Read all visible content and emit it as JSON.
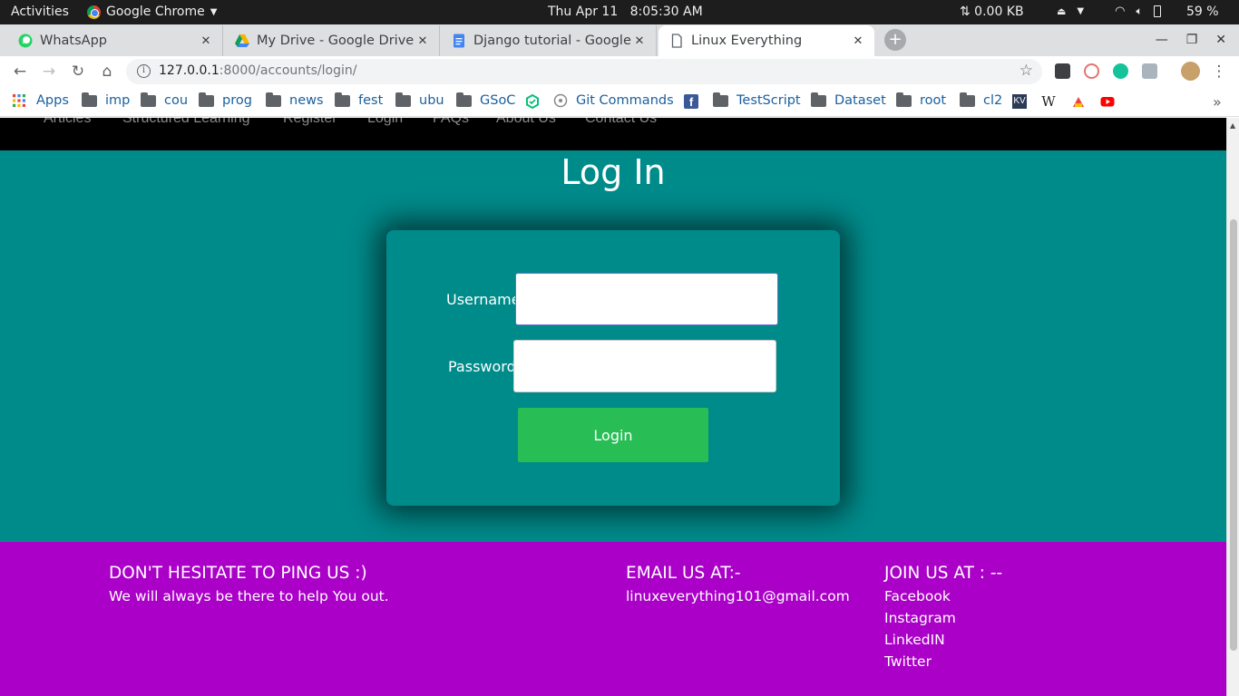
{
  "system_bar": {
    "activities": "Activities",
    "app_name": "Google Chrome",
    "clock": "Thu Apr 11   8:05:30 AM",
    "net_speed": "⇅ 0.00 KB",
    "battery": "59 %"
  },
  "tabs": [
    {
      "title": "WhatsApp",
      "icon": "whatsapp-icon",
      "active": false
    },
    {
      "title": "My Drive - Google Drive",
      "icon": "google-drive-icon",
      "active": false
    },
    {
      "title": "Django tutorial - Google D",
      "icon": "google-docs-icon",
      "active": false
    },
    {
      "title": "Linux Everything",
      "icon": "page-icon",
      "active": true
    }
  ],
  "address_bar": {
    "host": "127.0.0.1",
    "path": ":8000/accounts/login/"
  },
  "bookmarks": [
    {
      "label": "Apps",
      "icon": "apps-grid-icon"
    },
    {
      "label": "imp",
      "icon": "folder-icon"
    },
    {
      "label": "cou",
      "icon": "folder-icon"
    },
    {
      "label": "prog",
      "icon": "folder-icon"
    },
    {
      "label": "news",
      "icon": "folder-icon"
    },
    {
      "label": "fest",
      "icon": "folder-icon"
    },
    {
      "label": "ubu",
      "icon": "folder-icon"
    },
    {
      "label": "GSoC",
      "icon": "folder-icon"
    },
    {
      "label": "Git Commands",
      "icon": "git-icon"
    },
    {
      "label": "TestScript",
      "icon": "folder-icon"
    },
    {
      "label": "Dataset",
      "icon": "folder-icon"
    },
    {
      "label": "root",
      "icon": "folder-icon"
    },
    {
      "label": "cl2",
      "icon": "folder-icon"
    }
  ],
  "site_nav": [
    "Articles",
    "Structured Learning",
    "Register",
    "Login",
    "FAQs",
    "About Us",
    "Contact Us"
  ],
  "login": {
    "title": "Log In",
    "username_label": "Username:",
    "username_value": "",
    "password_label": "Password:",
    "password_value": "",
    "button_label": "Login"
  },
  "footer": {
    "ping_heading": "DON'T HESITATE TO PING US :)",
    "ping_text": "We will always be there to help You out.",
    "email_heading": "EMAIL US AT:-",
    "email": "linuxeverything101@gmail.com",
    "join_heading": "JOIN US AT : --",
    "social_links": [
      "Facebook",
      "Instagram",
      "LinkedIN",
      "Twitter"
    ]
  },
  "colors": {
    "page_background": "#008b8b",
    "footer_background": "#aa00c8",
    "login_button": "#28be55",
    "nav_background": "#000000"
  }
}
